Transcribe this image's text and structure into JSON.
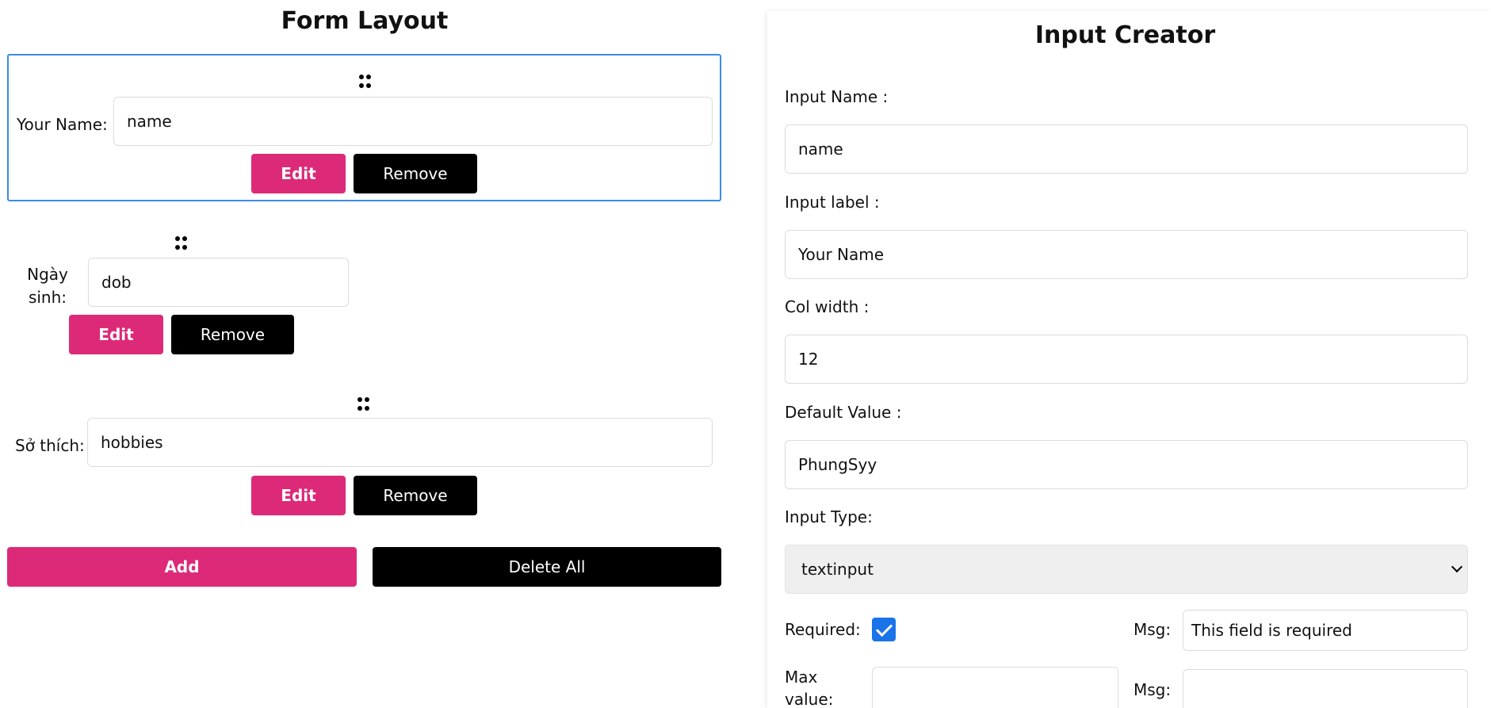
{
  "form_layout": {
    "title": "Form Layout",
    "fields": [
      {
        "label": "Your Name:",
        "value": "name",
        "edit_label": "Edit",
        "remove_label": "Remove"
      },
      {
        "label_line1": "Ngày",
        "label_line2": "sinh:",
        "value": "dob",
        "edit_label": "Edit",
        "remove_label": "Remove"
      },
      {
        "label": "Sở thích:",
        "value": "hobbies",
        "edit_label": "Edit",
        "remove_label": "Remove"
      }
    ],
    "add_label": "Add",
    "delete_all_label": "Delete All"
  },
  "input_creator": {
    "title": "Input Creator",
    "input_name_label": "Input Name :",
    "input_name_value": "name",
    "input_label_label": "Input label :",
    "input_label_value": "Your Name",
    "col_width_label": "Col width :",
    "col_width_value": "12",
    "default_value_label": "Default Value :",
    "default_value_value": "PhungSyy",
    "input_type_label": "Input Type:",
    "input_type_value": "textinput",
    "required_label": "Required:",
    "required_checked": true,
    "msg_label": "Msg:",
    "required_msg_value": "This field is required",
    "max_value_label_line1": "Max",
    "max_value_label_line2": "value:",
    "max_value_value": "",
    "max_msg_label": "Msg:",
    "max_msg_value": ""
  },
  "colors": {
    "accent_pink": "#dc2a78",
    "button_black": "#000000",
    "selected_border": "#3b8bea",
    "checkbox_blue": "#1a73e8"
  }
}
